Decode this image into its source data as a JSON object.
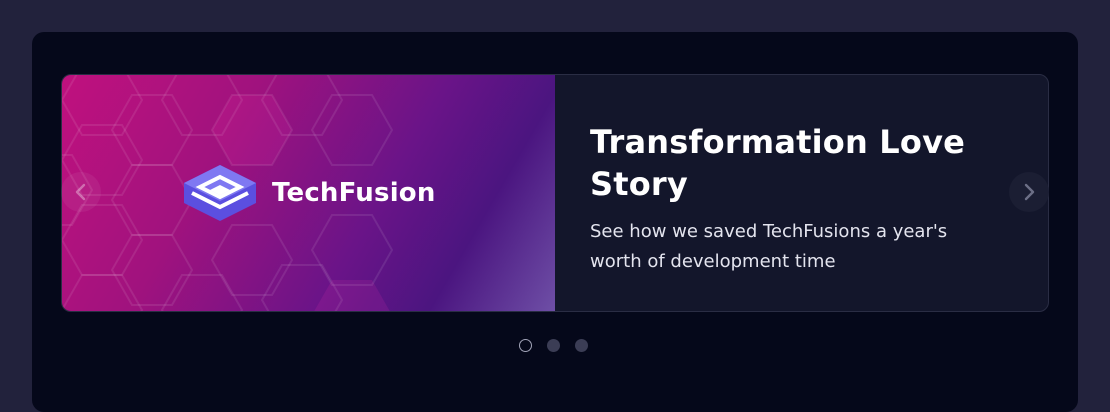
{
  "slide": {
    "brand_name": "TechFusion",
    "title": "Transformation Love Story",
    "description": "See how we saved TechFusions a year's worth of development time"
  },
  "navigation": {
    "prev_icon": "chevron-left-icon",
    "next_icon": "chevron-right-icon"
  },
  "pagination": {
    "count": 3,
    "active_index": 0
  },
  "colors": {
    "page_bg": "#22223c",
    "panel_bg": "#05081a",
    "card_bg": "#13162b",
    "gradient_start": "#c0117e",
    "gradient_end": "#6e4fa6"
  }
}
